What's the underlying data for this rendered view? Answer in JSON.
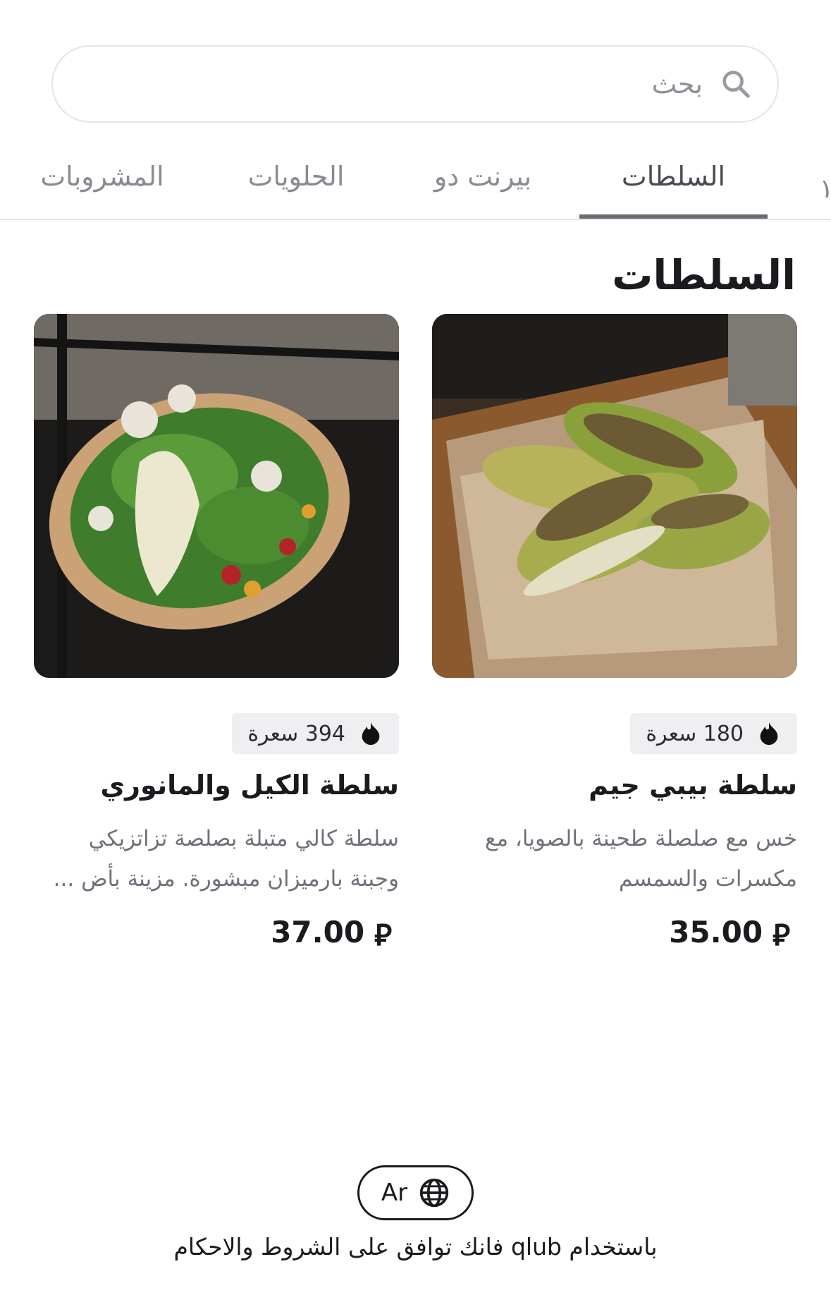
{
  "search": {
    "placeholder": "بحث"
  },
  "tabs": [
    {
      "label": "السلطات",
      "active": true
    },
    {
      "label": "بيرنت دو",
      "active": false
    },
    {
      "label": "الحلويات",
      "active": false
    },
    {
      "label": "المشروبات",
      "active": false
    }
  ],
  "section": {
    "title": "السلطات"
  },
  "items": [
    {
      "name": "سلطة بيبي جيم",
      "calories": "180 سعرة",
      "description": "خس مع صلصلة طحينة بالصويا، مع مكسرات والسمسم",
      "price": "35.00",
      "currency_symbol": "⃁"
    },
    {
      "name": "سلطة الكيل والمانوري",
      "calories": "394 سعرة",
      "description": "سلطة كالي متبلة بصلصة تزاتزيكي وجبنة بارميزان مبشورة. مزينة بأض ...",
      "price": "37.00",
      "currency_symbol": "⃁"
    }
  ],
  "footer": {
    "language_label": "Ar",
    "terms_prefix": "باستخدام qlub فانك توافق على ",
    "terms_link": "الشروط والاحكام"
  }
}
